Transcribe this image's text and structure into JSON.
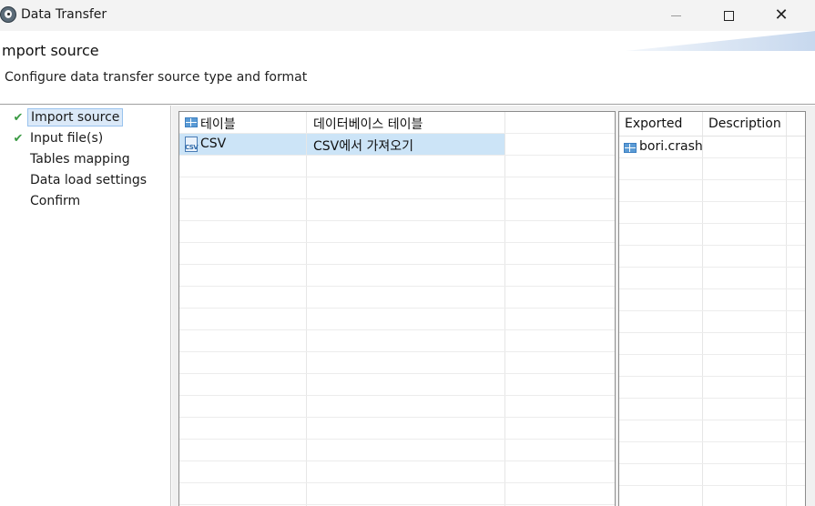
{
  "window": {
    "title": "Data Transfer",
    "icon": "dbeaver-beaver-icon",
    "controls": {
      "minimize": "minimize-icon",
      "maximize": "maximize-icon",
      "close": "✕"
    }
  },
  "header": {
    "title": "mport source",
    "subtitle": "Configure data transfer source type and format"
  },
  "nav": {
    "items": [
      {
        "label": "Import source",
        "checked": true,
        "selected": true
      },
      {
        "label": "Input file(s)",
        "checked": true,
        "selected": false
      },
      {
        "label": "Tables mapping",
        "checked": false,
        "selected": false
      },
      {
        "label": "Data load settings",
        "checked": false,
        "selected": false
      },
      {
        "label": "Confirm",
        "checked": false,
        "selected": false
      }
    ],
    "check_glyph": "✔"
  },
  "source_table": {
    "header": {
      "col1": "테이블",
      "col2": "데이터베이스 테이블",
      "col1_icon": "table-icon"
    },
    "rows": [
      {
        "col1": "CSV",
        "col2": "CSV에서 가져오기",
        "icon": "csv-file-icon",
        "icon_text": "CSV",
        "selected": true
      }
    ]
  },
  "target_table": {
    "columns": [
      "Exported",
      "Description"
    ],
    "rows": [
      {
        "exported": "bori.crash",
        "description": "",
        "icon": "table-icon"
      }
    ]
  },
  "colors": {
    "selection": "#cce4f7",
    "check": "#3a9a43",
    "nav_selection": "#dbe9f8",
    "table_icon": "#5b9bd5"
  }
}
